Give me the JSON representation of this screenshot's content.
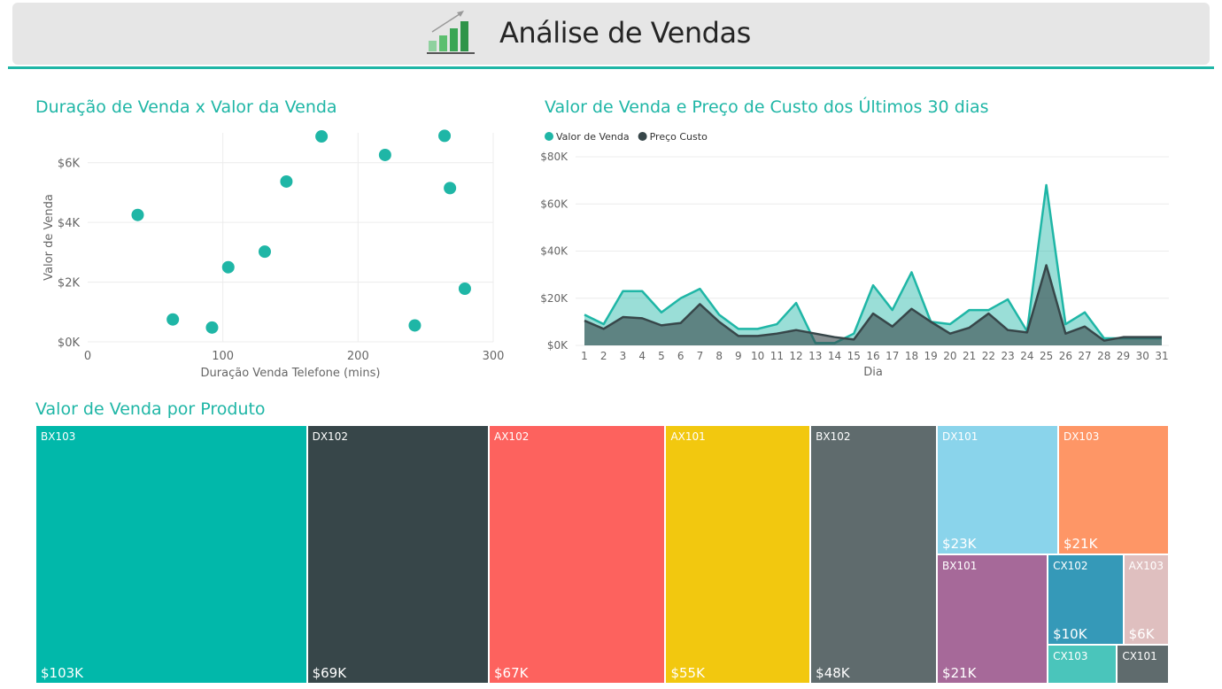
{
  "header": {
    "title": "Análise de Vendas",
    "logo_icon": "bar-growth-icon"
  },
  "colors": {
    "teal": "#1fb6a6",
    "dark": "#374649"
  },
  "chart_data": [
    {
      "type": "scatter",
      "title": "Duração de Venda x Valor da Venda",
      "xlabel": "Duração Venda Telefone (mins)",
      "ylabel": "Valor de Venda",
      "xlim": [
        0,
        300
      ],
      "ylim": [
        0,
        7000
      ],
      "xticks": [
        0,
        100,
        200,
        300
      ],
      "yticks": [
        0,
        2000,
        4000,
        6000
      ],
      "ytick_labels": [
        "$0K",
        "$2K",
        "$4K",
        "$6K"
      ],
      "grid": true,
      "points": [
        {
          "x": 37,
          "y": 4250
        },
        {
          "x": 63,
          "y": 750
        },
        {
          "x": 92,
          "y": 480
        },
        {
          "x": 104,
          "y": 2500
        },
        {
          "x": 131,
          "y": 3020
        },
        {
          "x": 147,
          "y": 5370
        },
        {
          "x": 173,
          "y": 6880
        },
        {
          "x": 220,
          "y": 6260
        },
        {
          "x": 242,
          "y": 550
        },
        {
          "x": 264,
          "y": 6900
        },
        {
          "x": 268,
          "y": 5150
        },
        {
          "x": 279,
          "y": 1780
        }
      ]
    },
    {
      "type": "area",
      "title": "Valor de Venda e Preço de Custo dos Últimos 30 dias",
      "xlabel": "Dia",
      "ylabel": "",
      "ylim": [
        0,
        80000
      ],
      "yticks": [
        0,
        20000,
        40000,
        60000,
        80000
      ],
      "ytick_labels": [
        "$0K",
        "$20K",
        "$40K",
        "$60K",
        "$80K"
      ],
      "legend_position": "top-left",
      "grid": true,
      "x": [
        1,
        2,
        3,
        4,
        5,
        6,
        7,
        8,
        9,
        10,
        11,
        12,
        13,
        14,
        15,
        16,
        17,
        18,
        19,
        20,
        21,
        22,
        23,
        24,
        25,
        26,
        27,
        28,
        29,
        30,
        31
      ],
      "series": [
        {
          "name": "Valor de Venda",
          "color": "#1fb6a6",
          "values": [
            13000,
            9000,
            23000,
            23000,
            14000,
            20000,
            24000,
            13000,
            7000,
            7000,
            9000,
            18000,
            1000,
            1000,
            5000,
            25500,
            15000,
            31000,
            10000,
            9000,
            15000,
            15000,
            19500,
            6000,
            68000,
            9000,
            14000,
            3000,
            3000,
            3000,
            3000
          ]
        },
        {
          "name": "Preço Custo",
          "color": "#374649",
          "values": [
            10500,
            7000,
            12000,
            11500,
            8500,
            9500,
            17500,
            10000,
            4000,
            4000,
            5000,
            6500,
            5000,
            3500,
            2500,
            13500,
            8000,
            15500,
            10000,
            5000,
            7500,
            13500,
            6500,
            5500,
            34000,
            5000,
            8000,
            2000,
            3500,
            3500,
            3500
          ]
        }
      ]
    },
    {
      "type": "treemap",
      "title": "Valor de Venda por Produto",
      "items": [
        {
          "name": "BX103",
          "value_label": "$103K",
          "value": 103,
          "color": "#01b8aa"
        },
        {
          "name": "DX102",
          "value_label": "$69K",
          "value": 69,
          "color": "#374649"
        },
        {
          "name": "AX102",
          "value_label": "$67K",
          "value": 67,
          "color": "#fd625e"
        },
        {
          "name": "AX101",
          "value_label": "$55K",
          "value": 55,
          "color": "#f2c80f"
        },
        {
          "name": "BX102",
          "value_label": "$48K",
          "value": 48,
          "color": "#5f6b6d"
        },
        {
          "name": "DX101",
          "value_label": "$23K",
          "value": 23,
          "color": "#8ad4eb"
        },
        {
          "name": "DX103",
          "value_label": "$21K",
          "value": 21,
          "color": "#fe9666"
        },
        {
          "name": "BX101",
          "value_label": "$21K",
          "value": 21,
          "color": "#a66999"
        },
        {
          "name": "CX102",
          "value_label": "$10K",
          "value": 10,
          "color": "#3599b8"
        },
        {
          "name": "AX103",
          "value_label": "$6K",
          "value": 6,
          "color": "#dfbfbf"
        },
        {
          "name": "CX103",
          "value_label": "",
          "value": 4,
          "color": "#4ac5bb"
        },
        {
          "name": "CX101",
          "value_label": "",
          "value": 3,
          "color": "#5f6b6d"
        }
      ]
    }
  ]
}
